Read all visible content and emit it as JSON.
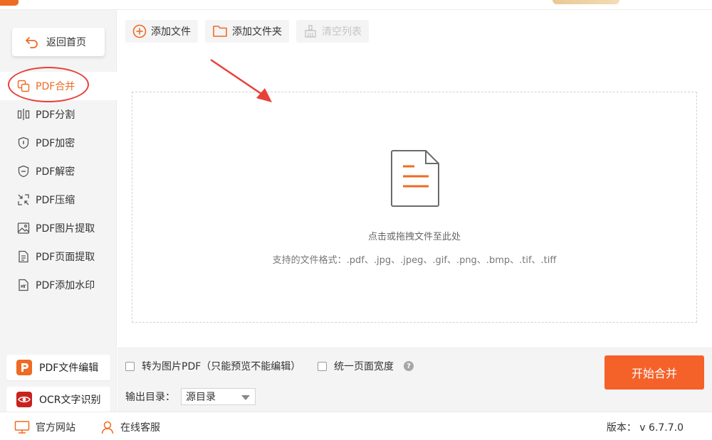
{
  "sidebar": {
    "back_label": "返回首页",
    "items": [
      {
        "label": "PDF合并",
        "icon": "merge-icon",
        "active": true
      },
      {
        "label": "PDF分割",
        "icon": "split-icon"
      },
      {
        "label": "PDF加密",
        "icon": "shield-lock-icon"
      },
      {
        "label": "PDF解密",
        "icon": "shield-minus-icon"
      },
      {
        "label": "PDF压缩",
        "icon": "compress-icon"
      },
      {
        "label": "PDF图片提取",
        "icon": "image-icon"
      },
      {
        "label": "PDF页面提取",
        "icon": "page-icon"
      },
      {
        "label": "PDF添加水印",
        "icon": "watermark-icon"
      }
    ],
    "tools": [
      {
        "label": "PDF文件编辑",
        "icon": "pdf-editor-logo-icon"
      },
      {
        "label": "OCR文字识别",
        "icon": "ocr-eye-icon"
      }
    ]
  },
  "toolbar": {
    "add_file": "添加文件",
    "add_folder": "添加文件夹",
    "clear_list": "清空列表"
  },
  "dropzone": {
    "hint": "点击或拖拽文件至此处",
    "formats": "支持的文件格式：.pdf、.jpg、.jpeg、.gif、.png、.bmp、.tif、.tiff"
  },
  "options": {
    "to_image_pdf": "转为图片PDF（只能预览不能编辑）",
    "uniform_width": "统一页面宽度",
    "help": "?",
    "output_dir_label": "输出目录：",
    "output_dir_value": "源目录"
  },
  "start_label": "开始合并",
  "statusbar": {
    "site": "官方网站",
    "service": "在线客服",
    "version": "版本：  v 6.7.7.0"
  },
  "colors": {
    "accent": "#ee6b23",
    "start_button": "#f4622a",
    "annotation": "#e8413a"
  }
}
